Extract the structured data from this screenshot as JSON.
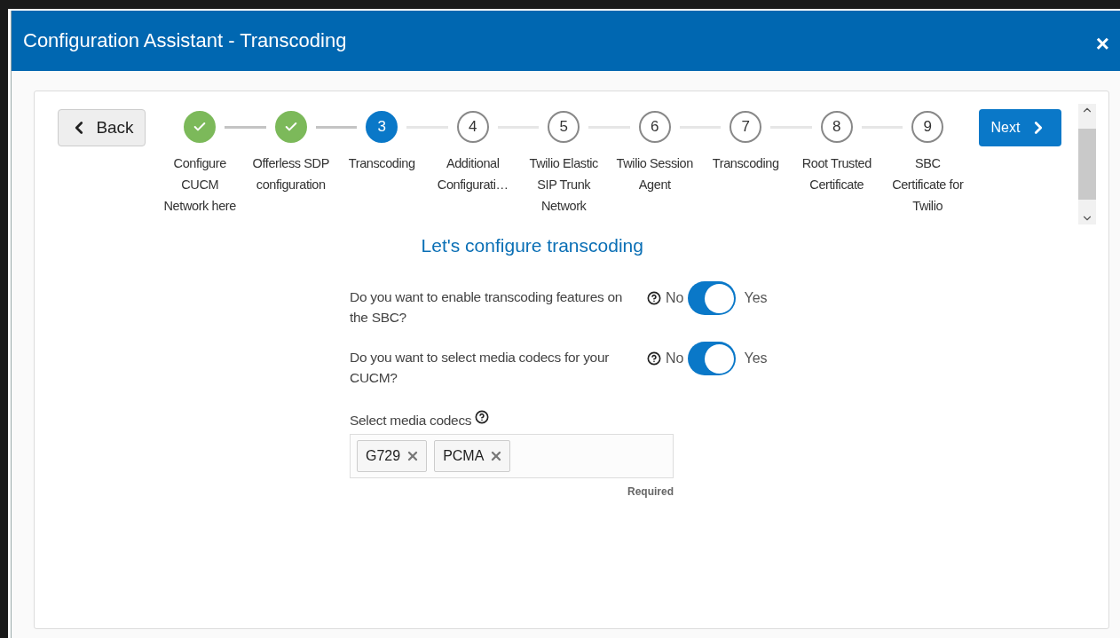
{
  "window": {
    "title": "Configuration Assistant - Transcoding",
    "close": "×"
  },
  "nav": {
    "back": "Back",
    "next": "Next"
  },
  "steps": [
    {
      "label": "Configure CUCM Network here",
      "kind": "done"
    },
    {
      "label": "Offerless SDP configuration",
      "kind": "done"
    },
    {
      "number": "3",
      "label": "Transcoding",
      "kind": "current"
    },
    {
      "number": "4",
      "label": "Additional Configurati…",
      "kind": "pending"
    },
    {
      "number": "5",
      "label": "Twilio Elastic SIP Trunk Network",
      "kind": "pending"
    },
    {
      "number": "6",
      "label": "Twilio Session Agent",
      "kind": "pending"
    },
    {
      "number": "7",
      "label": "Transcoding",
      "kind": "pending"
    },
    {
      "number": "8",
      "label": "Root Trusted Certificate",
      "kind": "pending"
    },
    {
      "number": "9",
      "label": "SBC Certificate for Twilio",
      "kind": "pending"
    }
  ],
  "heading": "Let's configure transcoding",
  "questions": [
    {
      "text": "Do you want to enable transcoding features on the SBC?",
      "off_label": "No",
      "on_label": "Yes",
      "on": true
    },
    {
      "text": "Do you want to select media codecs for your CUCM?",
      "off_label": "No",
      "on_label": "Yes",
      "on": true
    }
  ],
  "codecs": {
    "label": "Select media codecs",
    "tags": [
      "G729",
      "PCMA"
    ],
    "hint": "Required"
  }
}
